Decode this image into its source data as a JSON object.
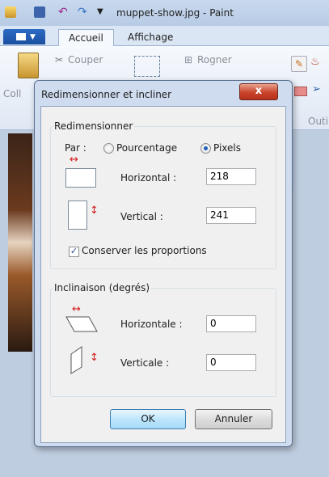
{
  "window": {
    "title": "muppet-show.jpg - Paint"
  },
  "ribbon": {
    "tabs": [
      "Accueil",
      "Affichage"
    ],
    "couper": "Couper",
    "rogner": "Rogner",
    "coller": "Coll",
    "outils": "Outi"
  },
  "dialog": {
    "title": "Redimensionner et incliner",
    "close_label": "x",
    "resize": {
      "group_label": "Redimensionner",
      "par_label": "Par :",
      "option_percent": "Pourcentage",
      "option_pixels": "Pixels",
      "selected": "Pixels",
      "horizontal_label": "Horizontal :",
      "horizontal_value": "218",
      "vertical_label": "Vertical :",
      "vertical_value": "241",
      "keep_ratio_label": "Conserver les proportions",
      "keep_ratio_checked": true
    },
    "skew": {
      "group_label": "Inclinaison (degrés)",
      "horizontal_label": "Horizontale :",
      "horizontal_value": "0",
      "vertical_label": "Verticale :",
      "vertical_value": "0"
    },
    "ok_label": "OK",
    "cancel_label": "Annuler"
  },
  "colors": {
    "accent_red": "#d21f1f",
    "title_bar": "#c9d9ee",
    "file_button": "#1a4f9f"
  }
}
